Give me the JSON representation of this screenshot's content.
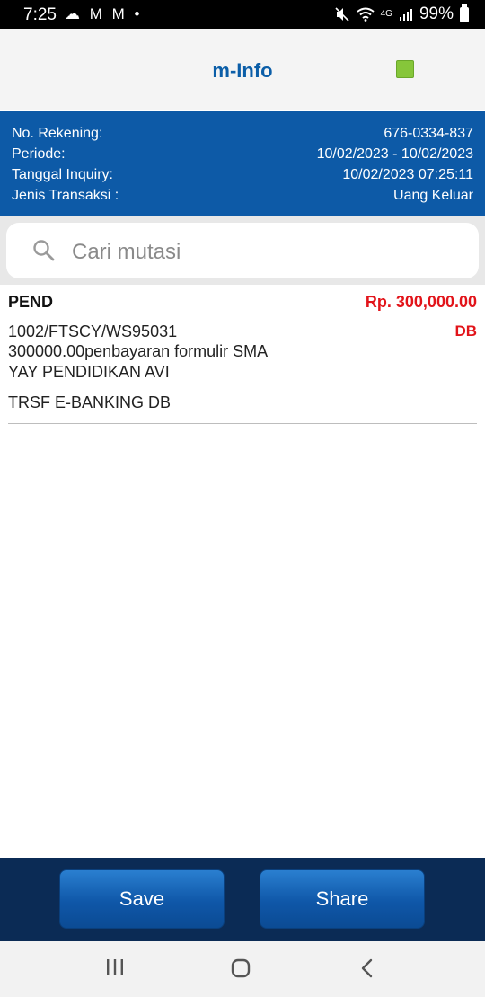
{
  "status_bar": {
    "time": "7:25",
    "notifications": "☁ M M •",
    "battery": "99%",
    "network": "4G"
  },
  "header": {
    "title": "m-Info"
  },
  "info": {
    "rows": [
      {
        "label": "No. Rekening:",
        "value": "676-0334-837"
      },
      {
        "label": "Periode:",
        "value": "10/02/2023 - 10/02/2023"
      },
      {
        "label": "Tanggal Inquiry:",
        "value": "10/02/2023 07:25:11"
      },
      {
        "label": "Jenis Transaksi :",
        "value": "Uang Keluar"
      }
    ]
  },
  "search": {
    "placeholder": "Cari mutasi"
  },
  "transactions": [
    {
      "type": "PEND",
      "amount": "Rp. 300,000.00",
      "ref": "1002/FTSCY/WS95031",
      "dbcr": "DB",
      "desc1": "300000.00penbayaran formulir SMA",
      "desc2": "YAY PENDIDIKAN AVI",
      "channel": "TRSF E-BANKING DB"
    }
  ],
  "actions": {
    "save_label": "Save",
    "share_label": "Share"
  },
  "colors": {
    "primary": "#0d5aa7",
    "accent_red": "#e2141a",
    "status_green": "#86c63a",
    "action_bar": "#0b2b55"
  }
}
